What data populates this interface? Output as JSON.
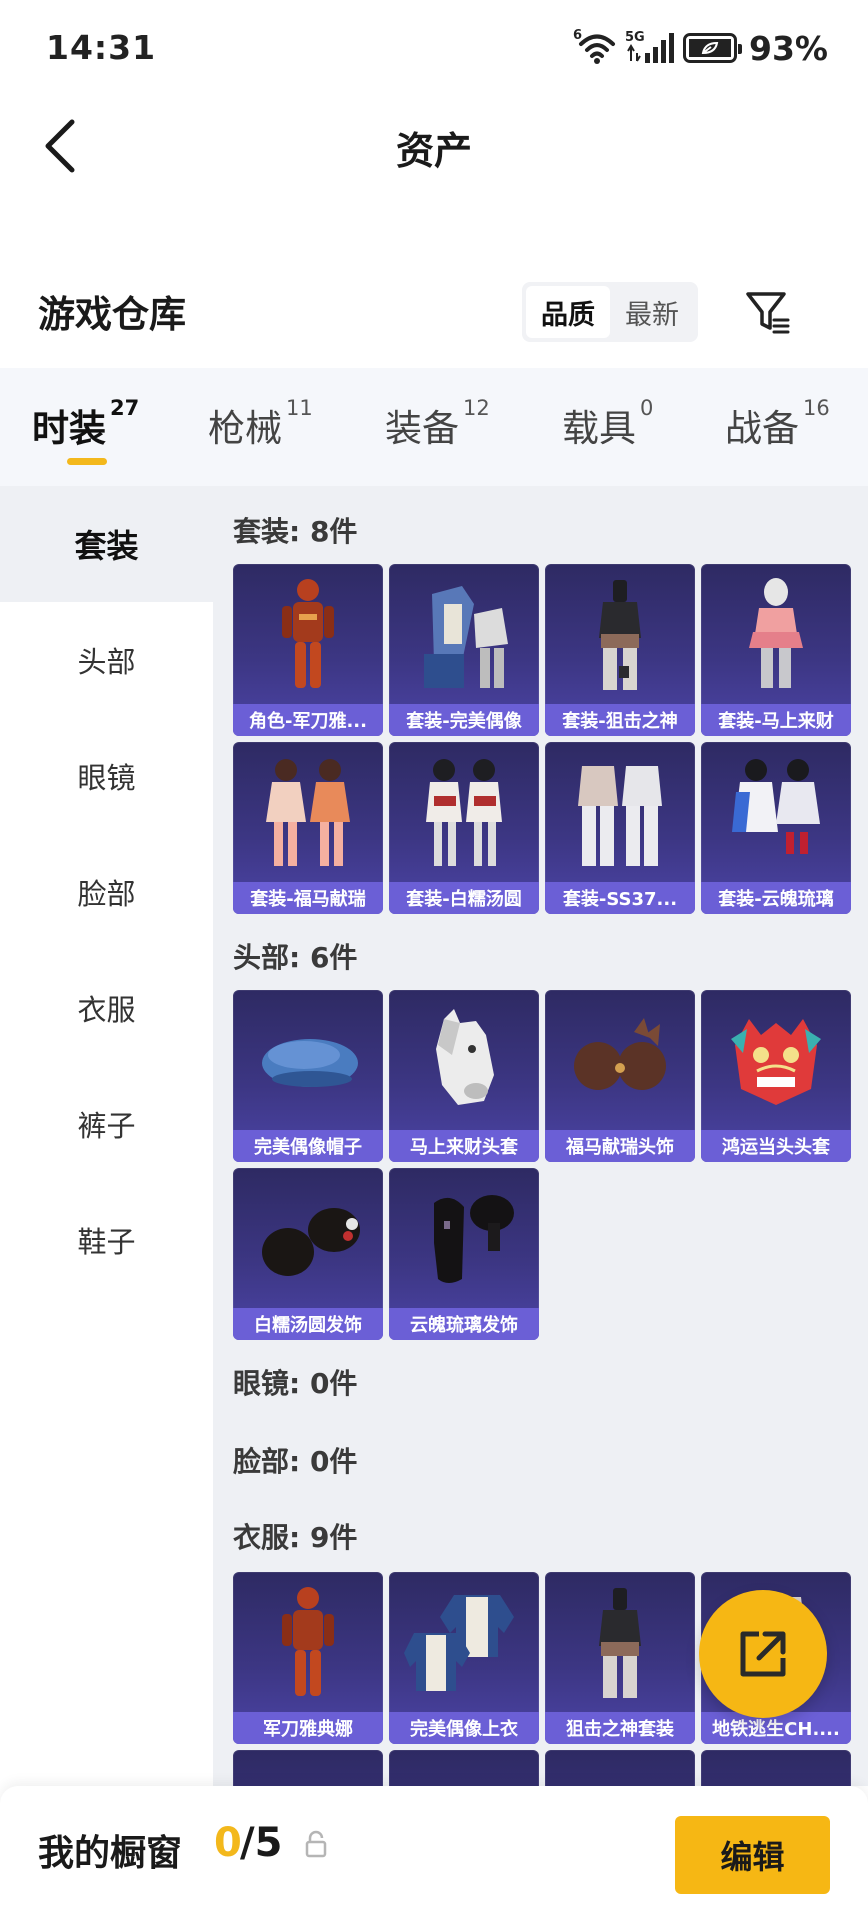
{
  "status": {
    "time": "14:31",
    "battery": "93%",
    "wifi_badge": "6",
    "net_badge": "5G"
  },
  "header": {
    "title": "资产"
  },
  "warehouse": {
    "title": "游戏仓库",
    "sort": [
      "品质",
      "最新"
    ],
    "sort_selected": "品质"
  },
  "tabs": [
    {
      "label": "时装",
      "count": "27",
      "active": true
    },
    {
      "label": "枪械",
      "count": "11"
    },
    {
      "label": "装备",
      "count": "12"
    },
    {
      "label": "载具",
      "count": "0"
    },
    {
      "label": "战备",
      "count": "16"
    }
  ],
  "sidebar": [
    "套装",
    "头部",
    "眼镜",
    "脸部",
    "衣服",
    "裤子",
    "鞋子"
  ],
  "sections": {
    "suits": {
      "title": "套装: 8件",
      "items": [
        "角色-军刀雅...",
        "套装-完美偶像",
        "套装-狙击之神",
        "套装-马上来财",
        "套装-福马献瑞",
        "套装-白糯汤圆",
        "套装-SS37...",
        "套装-云魄琉璃"
      ]
    },
    "head": {
      "title": "头部: 6件",
      "items": [
        "完美偶像帽子",
        "马上来财头套",
        "福马献瑞头饰",
        "鸿运当头头套",
        "白糯汤圆发饰",
        "云魄琉璃发饰"
      ]
    },
    "glasses": {
      "title": "眼镜: 0件"
    },
    "face": {
      "title": "脸部: 0件"
    },
    "clothes": {
      "title": "衣服: 9件",
      "items": [
        "军刀雅典娜",
        "完美偶像上衣",
        "狙击之神套装",
        "地铁逃生CH...."
      ]
    }
  },
  "bottom": {
    "showcase_label": "我的橱窗",
    "showcase_current": "0",
    "showcase_rest": "/5",
    "edit_label": "编辑"
  },
  "colors": {
    "accent": "#f6b714",
    "tile_label": "#6b5fd6",
    "tile_bg": "#3c3683"
  }
}
